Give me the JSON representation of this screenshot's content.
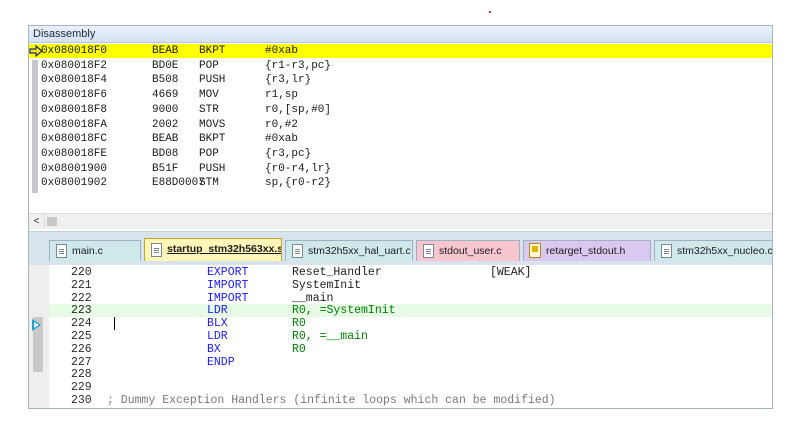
{
  "disassembly": {
    "title": "Disassembly",
    "rows": [
      {
        "addr": "0x080018F0",
        "op": "BEAB",
        "mn": "BKPT",
        "args": "#0xab",
        "current": true
      },
      {
        "addr": "0x080018F2",
        "op": "BD0E",
        "mn": "POP",
        "args": "{r1-r3,pc}"
      },
      {
        "addr": "0x080018F4",
        "op": "B508",
        "mn": "PUSH",
        "args": "{r3,lr}"
      },
      {
        "addr": "0x080018F6",
        "op": "4669",
        "mn": "MOV",
        "args": "r1,sp"
      },
      {
        "addr": "0x080018F8",
        "op": "9000",
        "mn": "STR",
        "args": "r0,[sp,#0]"
      },
      {
        "addr": "0x080018FA",
        "op": "2002",
        "mn": "MOVS",
        "args": "r0,#2"
      },
      {
        "addr": "0x080018FC",
        "op": "BEAB",
        "mn": "BKPT",
        "args": "#0xab"
      },
      {
        "addr": "0x080018FE",
        "op": "BD08",
        "mn": "POP",
        "args": "{r3,pc}"
      },
      {
        "addr": "0x08001900",
        "op": "B51F",
        "mn": "PUSH",
        "args": "{r0-r4,lr}"
      },
      {
        "addr": "0x08001902",
        "op": "E88D0007",
        "mn": "STM",
        "args": "sp,{r0-r2}"
      }
    ],
    "scroll_left": "<"
  },
  "tabs": [
    {
      "label": "main.c",
      "icon": "c-file-icon",
      "active": false
    },
    {
      "label": "startup_stm32h563xx.s",
      "icon": "asm-file-icon",
      "active": true
    },
    {
      "label": "stm32h5xx_hal_uart.c",
      "icon": "c-file-icon",
      "active": false
    },
    {
      "label": "stdout_user.c",
      "icon": "c-file-icon",
      "active": false
    },
    {
      "label": "retarget_stdout.h",
      "icon": "h-file-icon",
      "active": false
    },
    {
      "label": "stm32h5xx_nucleo.c",
      "icon": "c-file-icon",
      "active": false
    }
  ],
  "editor": {
    "lines": [
      {
        "num": "220",
        "kw": "EXPORT",
        "arg": "Reset_Handler",
        "extra": "[WEAK]"
      },
      {
        "num": "221",
        "kw": "IMPORT",
        "arg": "SystemInit"
      },
      {
        "num": "222",
        "kw": "IMPORT",
        "arg": "__main"
      },
      {
        "num": "223",
        "kw": "LDR",
        "arg": "R0, =SystemInit",
        "current": true
      },
      {
        "num": "224",
        "kw": "BLX",
        "arg": "R0"
      },
      {
        "num": "225",
        "kw": "LDR",
        "arg": "R0, =__main"
      },
      {
        "num": "226",
        "kw": "BX",
        "arg": "R0"
      },
      {
        "num": "227",
        "kw": "ENDP",
        "arg": ""
      },
      {
        "num": "228",
        "kw": "",
        "arg": ""
      },
      {
        "num": "229",
        "kw": "",
        "arg": ""
      },
      {
        "num": "230",
        "comment": "; Dummy Exception Handlers (infinite loops which can be modified)"
      }
    ]
  },
  "colors": {
    "current_disasm_bg": "#ffff00",
    "current_line_bg": "#e6fae6",
    "keyword": "#1a1aff",
    "register": "#008000",
    "active_tab_bg": "#fff6b8",
    "tab_pink": "#f7c6cf",
    "tab_purple": "#d9c8f0",
    "tab_teal": "#cfe9ea"
  }
}
